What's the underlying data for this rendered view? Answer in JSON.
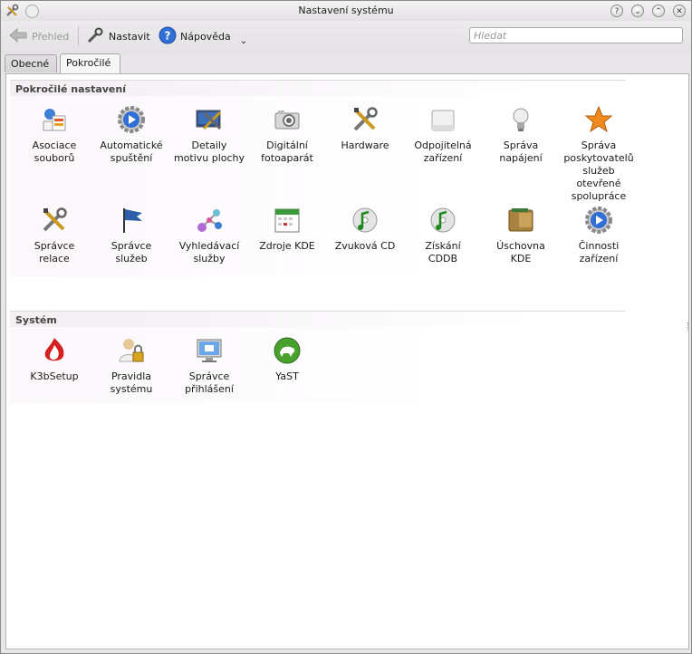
{
  "window": {
    "title": "Nastavení systému"
  },
  "toolbar": {
    "overview_label": "Přehled",
    "configure_label": "Nastavit",
    "help_label": "Nápověda",
    "search_placeholder": "Hledat"
  },
  "tabs": [
    {
      "label": "Obecné"
    },
    {
      "label": "Pokročilé"
    }
  ],
  "groups": [
    {
      "title": "Pokročilé nastavení",
      "items": [
        {
          "label": "Asociace\nsouborů",
          "icon": "file-associations-icon"
        },
        {
          "label": "Automatické\nspuštění",
          "icon": "autostart-gear-icon"
        },
        {
          "label": "Detaily\nmotivu plochy",
          "icon": "desktop-theme-icon"
        },
        {
          "label": "Digitální\nfotoaparát",
          "icon": "camera-icon"
        },
        {
          "label": "Hardware",
          "icon": "hardware-tools-icon"
        },
        {
          "label": "Odpojitelná\nzařízení",
          "icon": "removable-drive-icon"
        },
        {
          "label": "Správa\nnapájení",
          "icon": "lightbulb-icon"
        },
        {
          "label": "Správa\nposkytovatelů\nslužeb\notevřené\nspolupráce",
          "icon": "star-icon"
        },
        {
          "label": "Správce\nrelace",
          "icon": "session-tools-icon"
        },
        {
          "label": "Správce\nslužeb",
          "icon": "flag-icon"
        },
        {
          "label": "Vyhledávací\nslužby",
          "icon": "discovery-network-icon"
        },
        {
          "label": "Zdroje KDE",
          "icon": "calendar-icon"
        },
        {
          "label": "Zvuková CD",
          "icon": "audio-cd-icon"
        },
        {
          "label": "Získání\nCDDB",
          "icon": "cddb-cd-icon"
        },
        {
          "label": "Úschovna\nKDE",
          "icon": "wallet-icon"
        },
        {
          "label": "Činnosti\nzařízení",
          "icon": "device-actions-gear-icon"
        }
      ]
    },
    {
      "title": "Systém",
      "items": [
        {
          "label": "K3bSetup",
          "icon": "k3b-flame-icon"
        },
        {
          "label": "Pravidla\nsystému",
          "icon": "user-lock-icon"
        },
        {
          "label": "Správce\npřihlášení",
          "icon": "login-monitor-icon"
        },
        {
          "label": "YaST",
          "icon": "yast-chameleon-icon"
        }
      ]
    }
  ],
  "colors": {
    "accent_blue": "#2f6fd6",
    "group_tint": "#f2eef2"
  }
}
